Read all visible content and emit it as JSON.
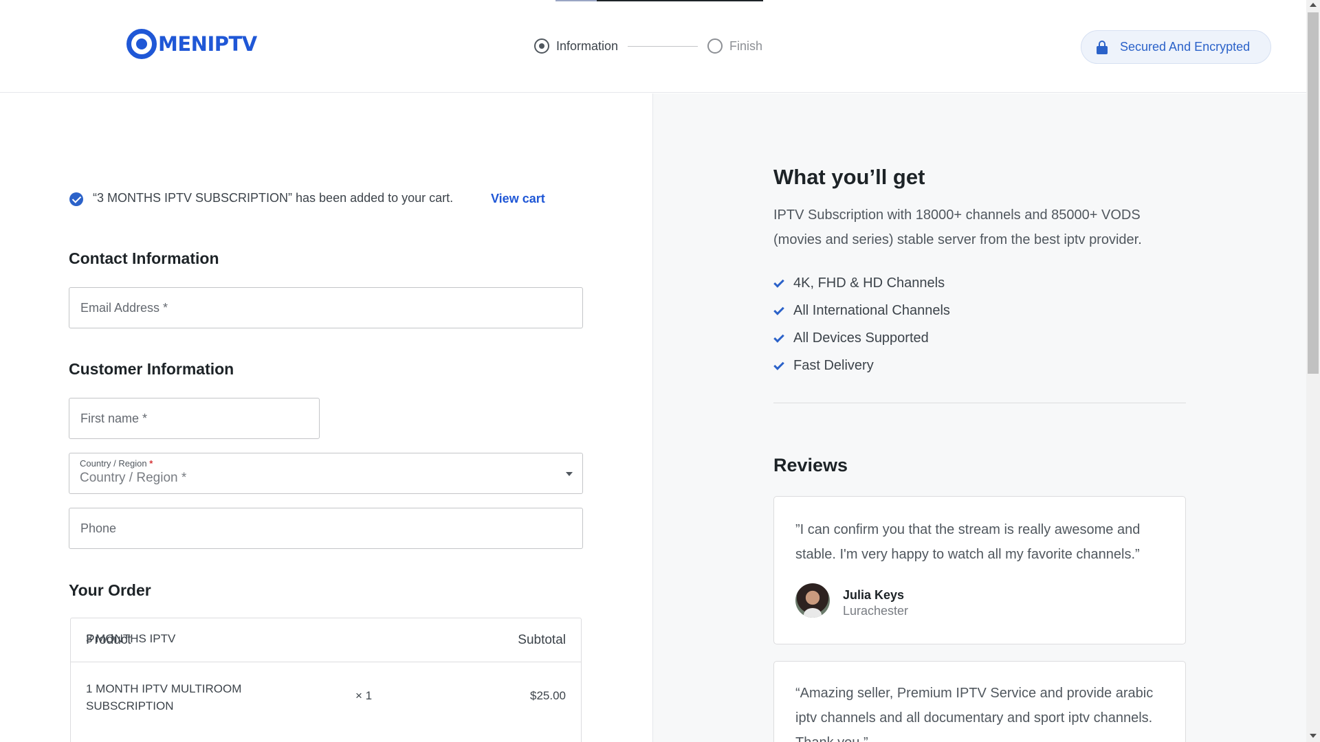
{
  "header": {
    "logo_text": "MENIPTV",
    "steps": [
      {
        "label": "Information",
        "state": "active"
      },
      {
        "label": "Finish",
        "state": "inactive"
      }
    ],
    "secure_badge": "Secured And Encrypted"
  },
  "notice": {
    "message": "“3 MONTHS IPTV SUBSCRIPTION” has been added to your cart.",
    "view_cart": "View cart"
  },
  "contact": {
    "title": "Contact Information",
    "email_placeholder": "Email Address *"
  },
  "customer": {
    "title": "Customer Information",
    "first_name_placeholder": "First name *",
    "country_label": "Country / Region",
    "country_required_mark": "*",
    "country_value": "Country / Region *",
    "phone_placeholder": "Phone"
  },
  "order": {
    "title": "Your Order",
    "col_product": "Product",
    "col_subtotal": "Subtotal",
    "items": [
      {
        "product": "1 MONTH IPTV MULTIROOM SUBSCRIPTION",
        "qty": "× 1",
        "price": "$25.00"
      },
      {
        "product": "3 MONTHS IPTV"
      }
    ]
  },
  "benefits": {
    "title": "What you’ll get",
    "description": "IPTV Subscription with 18000+ channels and 85000+ VODS (movies and series) stable server from the best iptv provider.",
    "features": [
      "4K, FHD & HD Channels",
      "All International Channels",
      "All Devices Supported",
      "Fast Delivery"
    ]
  },
  "reviews": {
    "title": "Reviews",
    "items": [
      {
        "quote": "”I can confirm you that the stream is really awesome and stable. I'm very happy to watch all my favorite channels.”",
        "name": "Julia Keys",
        "location": "Lurachester"
      },
      {
        "quote": "“Amazing seller, Premium IPTV Service and provide arabic iptv channels and all documentary and sport iptv channels. Thank you.”"
      }
    ]
  },
  "colors": {
    "brand_blue": "#1f57d6",
    "accent_blue": "#2b62c9",
    "right_panel_bg": "#f7f8f9"
  },
  "icons": [
    "logo-icon",
    "radio-active-icon",
    "radio-inactive-icon",
    "lock-icon",
    "check-circle-icon",
    "chevron-down-icon",
    "checkmark-icon"
  ]
}
